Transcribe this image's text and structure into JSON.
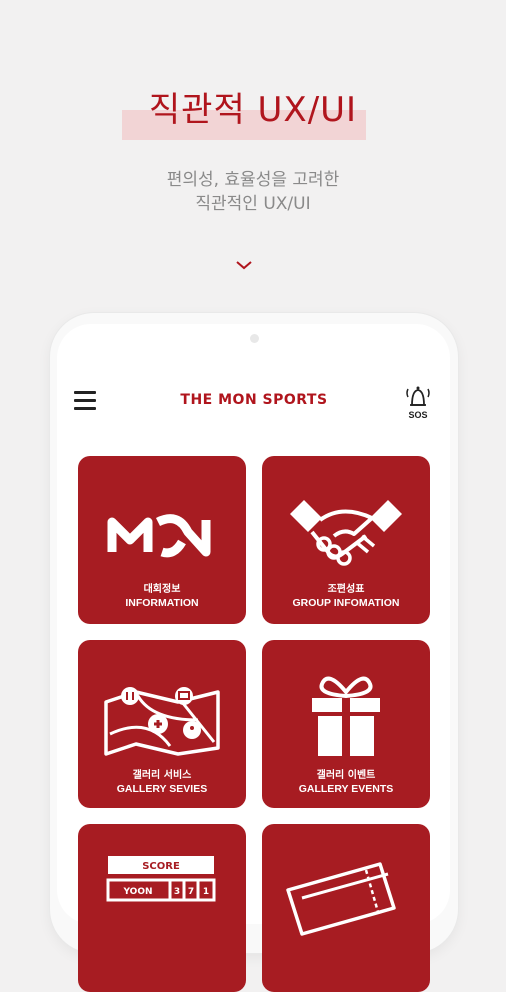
{
  "hero": {
    "title": "직관적 UX/UI",
    "subtitle_line1": "편의성, 효율성을 고려한",
    "subtitle_line2": "직관적인 UX/UI"
  },
  "app": {
    "brand": "THE MON SPORTS",
    "sos_label": "SOS",
    "tiles": [
      {
        "ko": "대회정보",
        "en": "INFORMATION",
        "icon": "mon-logo-icon"
      },
      {
        "ko": "조편성표",
        "en": "GROUP INFOMATION",
        "icon": "handshake-icon"
      },
      {
        "ko": "갤러리 서비스",
        "en": "GALLERY SEVIES",
        "icon": "map-icon"
      },
      {
        "ko": "갤러리 이벤트",
        "en": "GALLERY EVENTS",
        "icon": "gift-icon"
      },
      {
        "ko": "",
        "en": "",
        "icon": "scoreboard-icon"
      },
      {
        "ko": "",
        "en": "",
        "icon": "ticket-icon"
      }
    ],
    "scoreboard": {
      "label": "SCORE",
      "name": "YOON",
      "digits": [
        "3",
        "7",
        "1"
      ]
    }
  },
  "colors": {
    "accent": "#b0151d",
    "tile": "#a71c22",
    "background": "#f2f1f1"
  }
}
